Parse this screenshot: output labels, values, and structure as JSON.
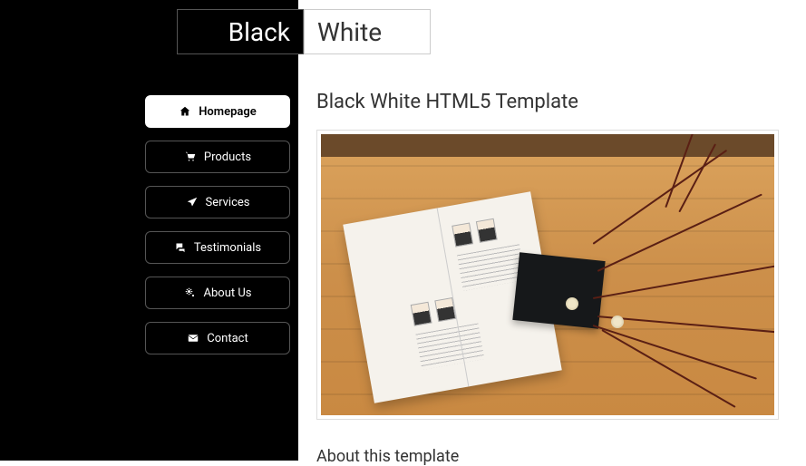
{
  "logo": {
    "left": "Black",
    "right": "White"
  },
  "nav": {
    "items": [
      {
        "label": "Homepage",
        "icon": "home-icon",
        "active": true
      },
      {
        "label": "Products",
        "icon": "cart-icon",
        "active": false
      },
      {
        "label": "Services",
        "icon": "plane-icon",
        "active": false
      },
      {
        "label": "Testimonials",
        "icon": "comments-icon",
        "active": false
      },
      {
        "label": "About Us",
        "icon": "gears-icon",
        "active": false
      },
      {
        "label": "Contact",
        "icon": "envelope-icon",
        "active": false
      }
    ]
  },
  "page": {
    "title": "Black White HTML5 Template",
    "subtitle": "About this template"
  }
}
